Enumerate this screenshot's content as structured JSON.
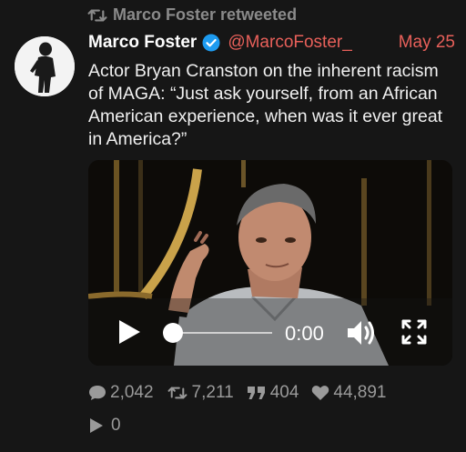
{
  "retweet": {
    "icon": "retweet-icon",
    "label": "Marco Foster retweeted"
  },
  "author": {
    "name": "Marco Foster",
    "verified_icon": "verified-badge-icon",
    "handle": "@MarcoFoster_",
    "date": "May 25"
  },
  "tweet": {
    "text": "Actor Bryan Cranston on the inherent racism of MAGA: “Just ask yourself, from an African American experience, when was it ever great in America?”"
  },
  "video": {
    "time": "0:00",
    "progress": 0,
    "play_icon": "play-icon",
    "volume_icon": "volume-icon",
    "fullscreen_icon": "fullscreen-icon"
  },
  "stats": {
    "replies": "2,042",
    "retweets": "7,211",
    "quotes": "404",
    "likes": "44,891"
  },
  "views": {
    "count": "0"
  },
  "colors": {
    "background": "#161616",
    "accent": "#e8605a",
    "verified": "#1d9bf0",
    "muted": "#9a9a9a"
  }
}
